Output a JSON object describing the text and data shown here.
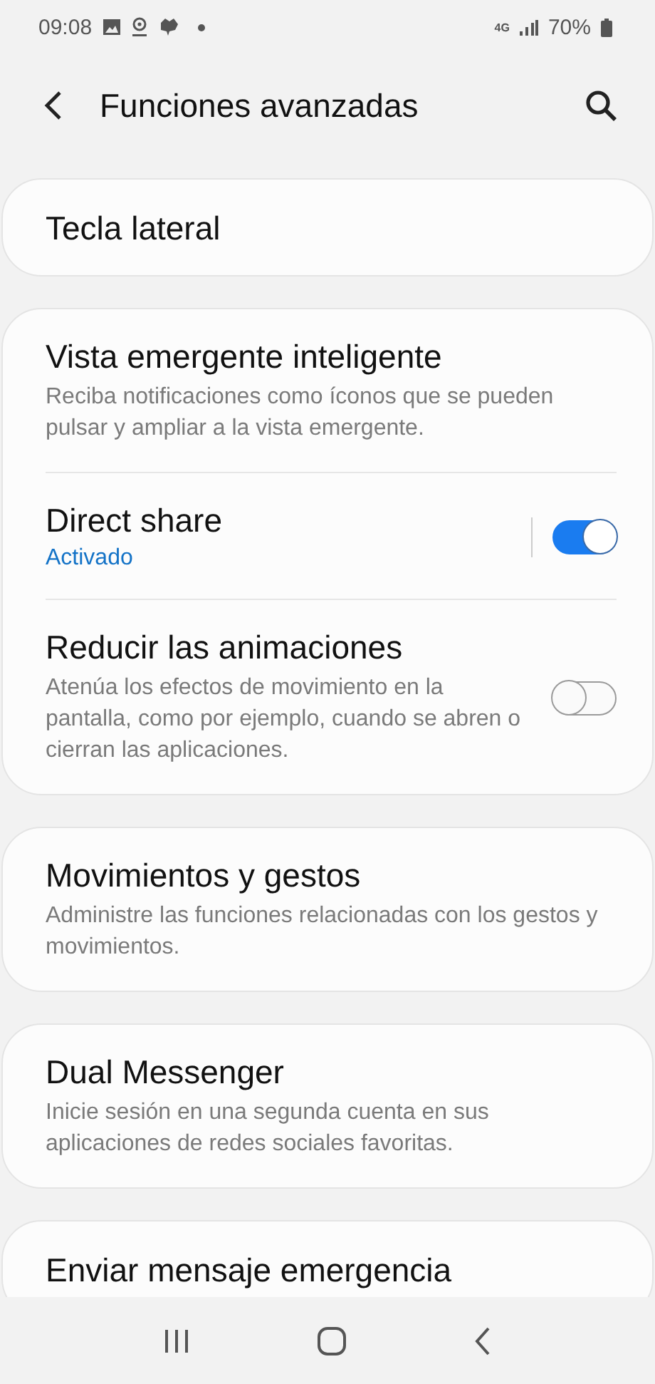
{
  "status_bar": {
    "time": "09:08",
    "network": "4G",
    "battery": "70%"
  },
  "header": {
    "title": "Funciones avanzadas"
  },
  "groups": [
    {
      "items": [
        {
          "kind": "plain",
          "title": "Tecla lateral"
        }
      ]
    },
    {
      "items": [
        {
          "kind": "plain",
          "title": "Vista emergente inteligente",
          "description": "Reciba notificaciones como íconos que se pueden pulsar y ampliar a la vista emergente."
        },
        {
          "kind": "link-switch",
          "title": "Direct share",
          "status": "Activado",
          "on": true
        },
        {
          "kind": "switch",
          "title": "Reducir las animaciones",
          "description": "Atenúa los efectos de movimiento en la pantalla, como por ejemplo, cuando se abren o cierran las aplicaciones.",
          "on": false
        }
      ]
    },
    {
      "items": [
        {
          "kind": "plain",
          "title": "Movimientos y gestos",
          "description": "Administre las funciones relacionadas con los gestos y movimientos."
        }
      ]
    },
    {
      "items": [
        {
          "kind": "plain",
          "title": "Dual Messenger",
          "description": "Inicie sesión en una segunda cuenta en sus aplicaciones de redes sociales favoritas."
        }
      ]
    },
    {
      "items": [
        {
          "kind": "plain",
          "title": "Enviar mensaje emergencia"
        }
      ]
    }
  ]
}
